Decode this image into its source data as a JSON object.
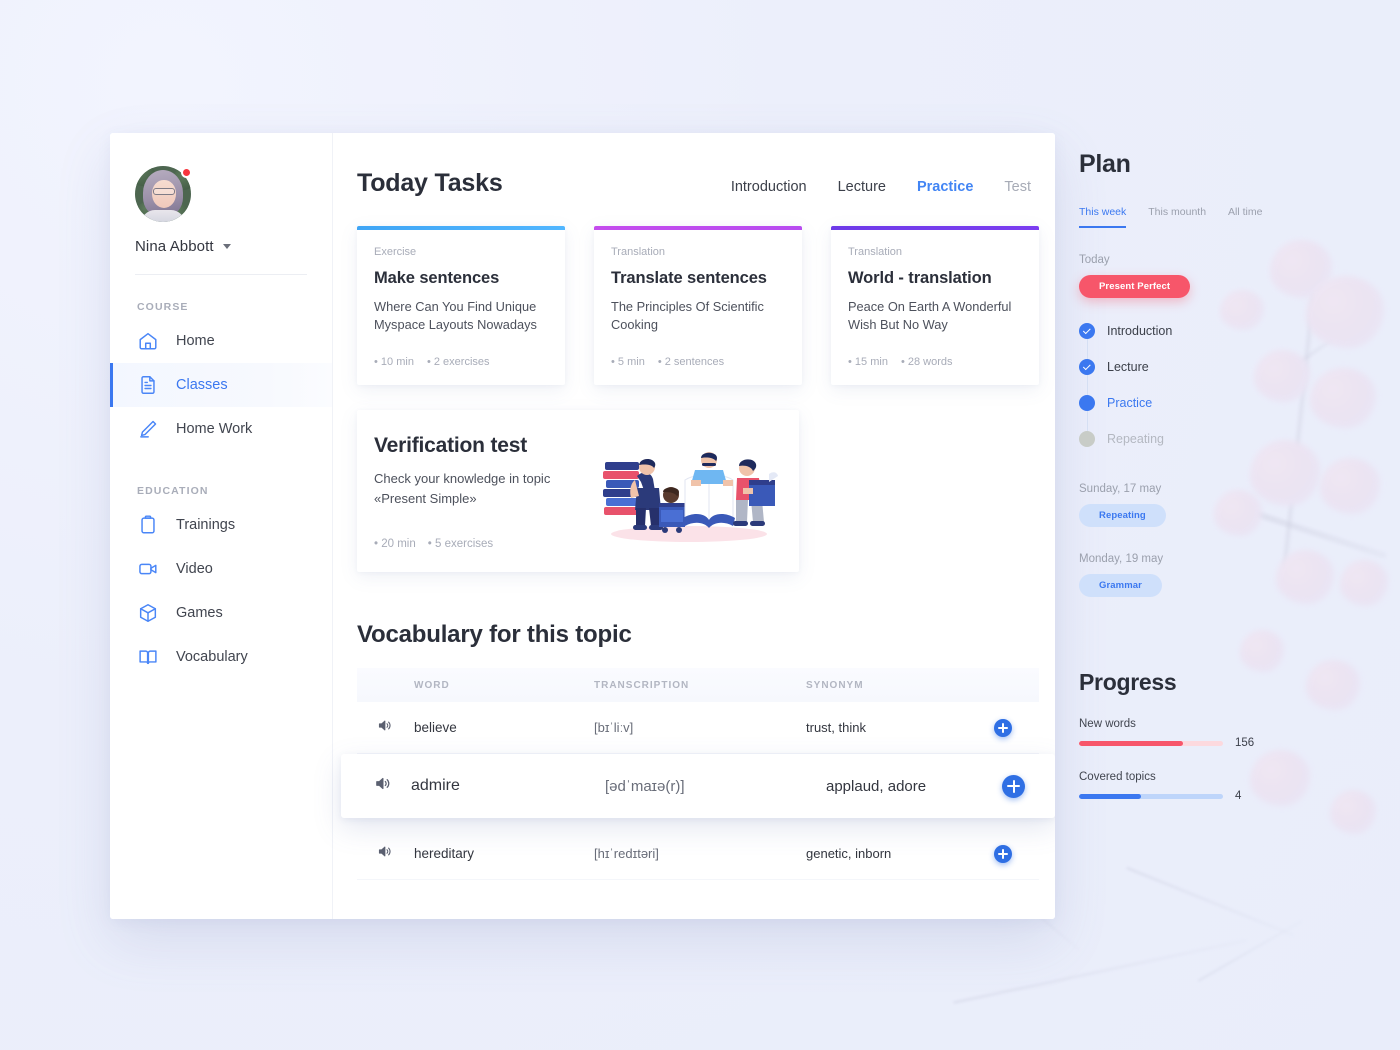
{
  "sidebar": {
    "user": {
      "name": "Nina Abbott",
      "has_notification_dot": true
    },
    "sections": [
      {
        "title": "COURSE",
        "items": [
          {
            "icon": "home-icon",
            "label": "Home",
            "active": false
          },
          {
            "icon": "document-icon",
            "label": "Classes",
            "active": true
          },
          {
            "icon": "pencil-icon",
            "label": "Home Work",
            "active": false
          }
        ]
      },
      {
        "title": "EDUCATION",
        "items": [
          {
            "icon": "clipboard-icon",
            "label": "Trainings",
            "active": false
          },
          {
            "icon": "video-icon",
            "label": "Video",
            "active": false
          },
          {
            "icon": "cube-icon",
            "label": "Games",
            "active": false
          },
          {
            "icon": "book-icon",
            "label": "Vocabulary",
            "active": false
          }
        ]
      }
    ]
  },
  "main": {
    "title": "Today Tasks",
    "tabs": [
      {
        "label": "Introduction",
        "state": "normal"
      },
      {
        "label": "Lecture",
        "state": "normal"
      },
      {
        "label": "Practice",
        "state": "active"
      },
      {
        "label": "Test",
        "state": "muted"
      }
    ],
    "task_cards": [
      {
        "kicker": "Exercise",
        "title": "Make sentences",
        "desc": "Where Can You Find Unique Myspace Layouts Nowadays",
        "duration": "10 min",
        "count": "2 exercises",
        "accent": "#3fa5f5"
      },
      {
        "kicker": "Translation",
        "title": "Translate sentences",
        "desc": "The Principles Of Scientific Cooking",
        "duration": "5 min",
        "count": "2 sentences",
        "accent": "#c44ced"
      },
      {
        "kicker": "Translation",
        "title": "World - translation",
        "desc": "Peace On Earth A Wonderful Wish But No Way",
        "duration": "15 min",
        "count": "28 words",
        "accent": "#6d3ae8"
      }
    ],
    "verification": {
      "title": "Verification test",
      "desc": "Check your knowledge in topic «Present Simple»",
      "duration": "20 min",
      "count": "5 exercises",
      "illustration": "people-with-books-illustration"
    },
    "vocabulary": {
      "title": "Vocabulary for this topic",
      "columns": [
        "WORD",
        "TRANSCRIPTION",
        "SYNONYM"
      ],
      "rows": [
        {
          "word": "believe",
          "transcription": "[bɪˈliːv]",
          "synonym": "trust, think",
          "highlighted": false
        },
        {
          "word": "admire",
          "transcription": "[ədˈmaɪə(r)]",
          "synonym": "applaud, adore",
          "highlighted": true
        },
        {
          "word": "hereditary",
          "transcription": "[hɪˈredɪtəri]",
          "synonym": "genetic, inborn",
          "highlighted": false
        }
      ],
      "add_label": "+"
    }
  },
  "rail": {
    "plan": {
      "title": "Plan",
      "tabs": [
        {
          "label": "This week",
          "active": true
        },
        {
          "label": "This mounth",
          "active": false
        },
        {
          "label": "All time",
          "active": false
        }
      ],
      "groups": [
        {
          "day": "Today",
          "chip": "Present Perfect",
          "chip_color": "pink"
        },
        {
          "day": "Sunday, 17 may",
          "chip": "Repeating",
          "chip_color": "blue"
        },
        {
          "day": "Monday, 19 may",
          "chip": "Grammar",
          "chip_color": "blue"
        }
      ],
      "steps": [
        {
          "label": "Introduction",
          "state": "done"
        },
        {
          "label": "Lecture",
          "state": "done"
        },
        {
          "label": "Practice",
          "state": "current"
        },
        {
          "label": "Repeating",
          "state": "todo"
        }
      ]
    },
    "progress": {
      "title": "Progress",
      "items": [
        {
          "label": "New words",
          "value": "156",
          "percent": 72,
          "color": "pink"
        },
        {
          "label": "Covered topics",
          "value": "4",
          "percent": 43,
          "color": "blue"
        }
      ]
    }
  },
  "colors": {
    "accent_blue": "#3b78f0",
    "accent_pink": "#f7566a",
    "page_bg": "#eceffb",
    "card_bg": "#ffffff"
  }
}
